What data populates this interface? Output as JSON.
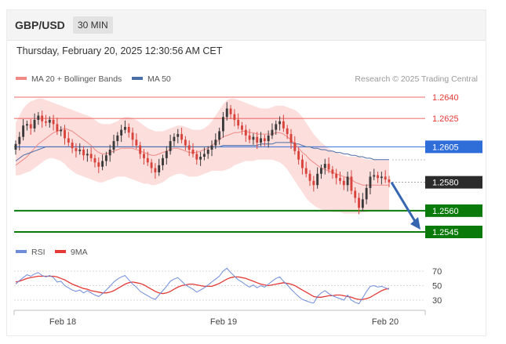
{
  "header": {
    "pair": "GBP/USD",
    "timeframe": "30 MIN"
  },
  "timestamp": "Thursday, February 20, 2025 12:30:56 AM CET",
  "legend": {
    "ma20_bb": "MA 20 + Bollinger Bands",
    "ma50": "MA 50",
    "research": "Research © 2025 Trading Central",
    "rsi": "RSI",
    "rsi_ma": "9MA"
  },
  "colors": {
    "up": "#3a3a3a",
    "down": "#d8433c",
    "bollinger_fill": "#fbd6d4",
    "ma20": "#f08a85",
    "ma50": "#4a6fa8",
    "resistance": "#e53935",
    "pivot": "#2f6dd8",
    "support": "#0a7a0a",
    "last": "#2b2b2b",
    "rsi": "#6f8cd9",
    "rsi_ma": "#e53935",
    "arrow": "#3766b1"
  },
  "chart_data": [
    {
      "type": "candlestick",
      "ylim": [
        1.2545,
        1.2645
      ],
      "x_ticks": [
        "Feb 18",
        "Feb 19",
        "Feb 20"
      ],
      "levels": [
        {
          "value": 1.264,
          "label": "1.2640",
          "kind": "resistance"
        },
        {
          "value": 1.2625,
          "label": "1.2625",
          "kind": "resistance"
        },
        {
          "value": 1.2605,
          "label": "1.2605",
          "kind": "pivot"
        },
        {
          "value": 1.258,
          "label": "1.2580",
          "kind": "last"
        },
        {
          "value": 1.256,
          "label": "1.2560",
          "kind": "support"
        },
        {
          "value": 1.2545,
          "label": "1.2545",
          "kind": "support"
        }
      ],
      "close": [
        1.2607,
        1.2612,
        1.262,
        1.2621,
        1.2618,
        1.2624,
        1.2627,
        1.2623,
        1.2622,
        1.2624,
        1.2621,
        1.2616,
        1.2617,
        1.2611,
        1.2608,
        1.2604,
        1.2602,
        1.2603,
        1.2599,
        1.26,
        1.2597,
        1.2594,
        1.2591,
        1.2595,
        1.2599,
        1.2603,
        1.2609,
        1.2613,
        1.2617,
        1.2619,
        1.2615,
        1.261,
        1.2606,
        1.26,
        1.2597,
        1.2594,
        1.259,
        1.2587,
        1.2592,
        1.2597,
        1.2602,
        1.2609,
        1.2612,
        1.2614,
        1.261,
        1.2606,
        1.2603,
        1.26,
        1.2596,
        1.2598,
        1.26,
        1.2603,
        1.2606,
        1.261,
        1.2616,
        1.2626,
        1.2632,
        1.2628,
        1.2624,
        1.262,
        1.2617,
        1.2613,
        1.261,
        1.2612,
        1.2608,
        1.2611,
        1.2609,
        1.2613,
        1.2617,
        1.2621,
        1.2623,
        1.2618,
        1.2614,
        1.2608,
        1.2602,
        1.2596,
        1.259,
        1.2586,
        1.2581,
        1.2578,
        1.2586,
        1.259,
        1.2593,
        1.2589,
        1.2586,
        1.2583,
        1.2581,
        1.2578,
        1.2584,
        1.2574,
        1.2569,
        1.2562,
        1.2568,
        1.2576,
        1.2584,
        1.2585,
        1.2583,
        1.2584,
        1.2582,
        1.258
      ],
      "ma20": [
        1.2592,
        1.2594,
        1.2596,
        1.2598,
        1.2601,
        1.2604,
        1.2607,
        1.2609,
        1.2611,
        1.2613,
        1.2615,
        1.2616,
        1.2617,
        1.2618,
        1.2617,
        1.2616,
        1.2614,
        1.2612,
        1.261,
        1.2608,
        1.2606,
        1.2603,
        1.2601,
        1.26,
        1.26,
        1.2601,
        1.2602,
        1.2603,
        1.2604,
        1.2604,
        1.2604,
        1.2604,
        1.2603,
        1.2602,
        1.2601,
        1.26,
        1.2599,
        1.2599,
        1.26,
        1.2601,
        1.2602,
        1.2603,
        1.2604,
        1.2604,
        1.2603,
        1.2602,
        1.2601,
        1.2601,
        1.2601,
        1.2602,
        1.2603,
        1.2604,
        1.2606,
        1.2608,
        1.261,
        1.2612,
        1.2613,
        1.2614,
        1.2615,
        1.2615,
        1.2616,
        1.2616,
        1.2615,
        1.2615,
        1.2614,
        1.2614,
        1.2614,
        1.2614,
        1.2614,
        1.2615,
        1.2615,
        1.2614,
        1.2612,
        1.261,
        1.2607,
        1.2604,
        1.2601,
        1.2599,
        1.2596,
        1.2594,
        1.2592,
        1.259,
        1.2589,
        1.2588,
        1.2587,
        1.2586,
        1.2585,
        1.2584,
        1.2583,
        1.2582,
        1.258,
        1.2579,
        1.2578,
        1.2578,
        1.2578,
        1.2578,
        1.2578,
        1.2578,
        1.2578,
        1.2578
      ],
      "bb_upper": [
        1.2622,
        1.2627,
        1.2632,
        1.2635,
        1.2637,
        1.2638,
        1.2639,
        1.2639,
        1.2638,
        1.2637,
        1.2636,
        1.2635,
        1.2634,
        1.2633,
        1.2632,
        1.2631,
        1.263,
        1.2629,
        1.2628,
        1.2627,
        1.2626,
        1.2624,
        1.2622,
        1.2621,
        1.2621,
        1.2621,
        1.2622,
        1.2623,
        1.2625,
        1.2626,
        1.2626,
        1.2625,
        1.2624,
        1.2622,
        1.262,
        1.2618,
        1.2617,
        1.2616,
        1.2616,
        1.2616,
        1.2617,
        1.2618,
        1.2619,
        1.262,
        1.262,
        1.2619,
        1.2618,
        1.2617,
        1.2617,
        1.2617,
        1.2618,
        1.262,
        1.2623,
        1.2627,
        1.2631,
        1.2635,
        1.2638,
        1.2639,
        1.2639,
        1.2638,
        1.2637,
        1.2636,
        1.2635,
        1.2634,
        1.2633,
        1.2632,
        1.2632,
        1.2632,
        1.2633,
        1.2634,
        1.2634,
        1.2634,
        1.2633,
        1.2632,
        1.2631,
        1.2629,
        1.2626,
        1.2622,
        1.2618,
        1.2614,
        1.2611,
        1.2608,
        1.2606,
        1.2604,
        1.2602,
        1.2601,
        1.26,
        1.2599,
        1.2598,
        1.2598,
        1.2598,
        1.2598,
        1.2597,
        1.2596,
        1.2596,
        1.2596,
        1.2596,
        1.2596,
        1.2596,
        1.2596
      ],
      "bb_lower": [
        1.2585,
        1.2585,
        1.2586,
        1.2587,
        1.2588,
        1.259,
        1.2592,
        1.2594,
        1.2596,
        1.2597,
        1.2597,
        1.2596,
        1.2595,
        1.2593,
        1.259,
        1.2588,
        1.2586,
        1.2585,
        1.2584,
        1.2583,
        1.2582,
        1.2581,
        1.258,
        1.258,
        1.2581,
        1.2582,
        1.2583,
        1.2584,
        1.2584,
        1.2584,
        1.2583,
        1.2582,
        1.2581,
        1.258,
        1.2579,
        1.2579,
        1.2578,
        1.2578,
        1.2579,
        1.258,
        1.2582,
        1.2584,
        1.2585,
        1.2586,
        1.2586,
        1.2585,
        1.2584,
        1.2584,
        1.2584,
        1.2585,
        1.2586,
        1.2587,
        1.2588,
        1.2588,
        1.2588,
        1.2588,
        1.2589,
        1.259,
        1.2592,
        1.2593,
        1.2594,
        1.2595,
        1.2595,
        1.2595,
        1.2596,
        1.2596,
        1.2596,
        1.2596,
        1.2596,
        1.2595,
        1.2594,
        1.2592,
        1.2589,
        1.2585,
        1.2581,
        1.2577,
        1.2573,
        1.2569,
        1.2566,
        1.2564,
        1.2562,
        1.2561,
        1.256,
        1.256,
        1.2559,
        1.2559,
        1.2559,
        1.2558,
        1.2558,
        1.2558,
        1.2558,
        1.2558,
        1.2559,
        1.2559,
        1.256,
        1.256,
        1.256,
        1.256,
        1.256,
        1.256
      ],
      "ma50": [
        1.2595,
        1.2597,
        1.2599,
        1.26,
        1.2601,
        1.2602,
        1.2603,
        1.2604,
        1.2605,
        1.2605,
        1.2605,
        1.2605,
        1.2605,
        1.2605,
        1.2605,
        1.2605,
        1.2605,
        1.2605,
        1.2605,
        1.2605,
        1.2605,
        1.2605,
        1.2605,
        1.2605,
        1.2605,
        1.2605,
        1.2605,
        1.2605,
        1.2605,
        1.2605,
        1.2605,
        1.2605,
        1.2605,
        1.2605,
        1.2605,
        1.2605,
        1.2605,
        1.2605,
        1.2605,
        1.2605,
        1.2605,
        1.2605,
        1.2605,
        1.2605,
        1.2605,
        1.2605,
        1.2605,
        1.2605,
        1.2605,
        1.2605,
        1.2605,
        1.2605,
        1.2605,
        1.2605,
        1.2605,
        1.2606,
        1.2606,
        1.2606,
        1.2606,
        1.2606,
        1.2606,
        1.2606,
        1.2606,
        1.2606,
        1.2606,
        1.2607,
        1.2607,
        1.2607,
        1.2607,
        1.2608,
        1.2608,
        1.2608,
        1.2608,
        1.2608,
        1.2607,
        1.2607,
        1.2606,
        1.2605,
        1.2605,
        1.2604,
        1.2604,
        1.2603,
        1.2603,
        1.2602,
        1.2602,
        1.2601,
        1.2601,
        1.26,
        1.26,
        1.2599,
        1.2599,
        1.2598,
        1.2598,
        1.2597,
        1.2597,
        1.2596,
        1.2596,
        1.2596,
        1.2596,
        1.2596
      ]
    },
    {
      "type": "line",
      "name": "RSI",
      "ylim": [
        20,
        80
      ],
      "ticks": [
        70,
        50,
        30
      ],
      "series": [
        {
          "name": "RSI",
          "values": [
            52,
            57,
            61,
            65,
            63,
            66,
            68,
            64,
            62,
            64,
            61,
            55,
            56,
            50,
            47,
            44,
            42,
            44,
            40,
            43,
            40,
            37,
            35,
            39,
            44,
            49,
            55,
            59,
            62,
            64,
            58,
            52,
            48,
            42,
            39,
            36,
            33,
            31,
            37,
            43,
            49,
            56,
            59,
            61,
            56,
            51,
            48,
            45,
            41,
            44,
            47,
            51,
            55,
            59,
            63,
            70,
            74,
            68,
            63,
            58,
            55,
            51,
            48,
            51,
            47,
            50,
            48,
            52,
            56,
            60,
            62,
            56,
            51,
            45,
            40,
            35,
            31,
            29,
            27,
            26,
            35,
            40,
            43,
            39,
            36,
            34,
            32,
            30,
            37,
            30,
            27,
            25,
            33,
            42,
            49,
            50,
            48,
            49,
            47,
            45
          ]
        },
        {
          "name": "9MA",
          "values": [
            55,
            56,
            58,
            60,
            61,
            62,
            63,
            63,
            63,
            63,
            63,
            62,
            60,
            58,
            55,
            52,
            50,
            48,
            46,
            45,
            43,
            42,
            41,
            40,
            40,
            41,
            43,
            46,
            49,
            52,
            54,
            55,
            54,
            53,
            51,
            48,
            45,
            42,
            40,
            39,
            40,
            42,
            45,
            48,
            50,
            51,
            52,
            52,
            51,
            50,
            49,
            49,
            49,
            51,
            53,
            56,
            59,
            61,
            62,
            62,
            61,
            60,
            58,
            56,
            54,
            52,
            51,
            50,
            51,
            52,
            53,
            54,
            53,
            52,
            50,
            47,
            44,
            41,
            38,
            35,
            34,
            34,
            35,
            36,
            36,
            37,
            37,
            36,
            35,
            34,
            32,
            31,
            31,
            32,
            34,
            37,
            40,
            43,
            45,
            46
          ]
        }
      ]
    }
  ]
}
